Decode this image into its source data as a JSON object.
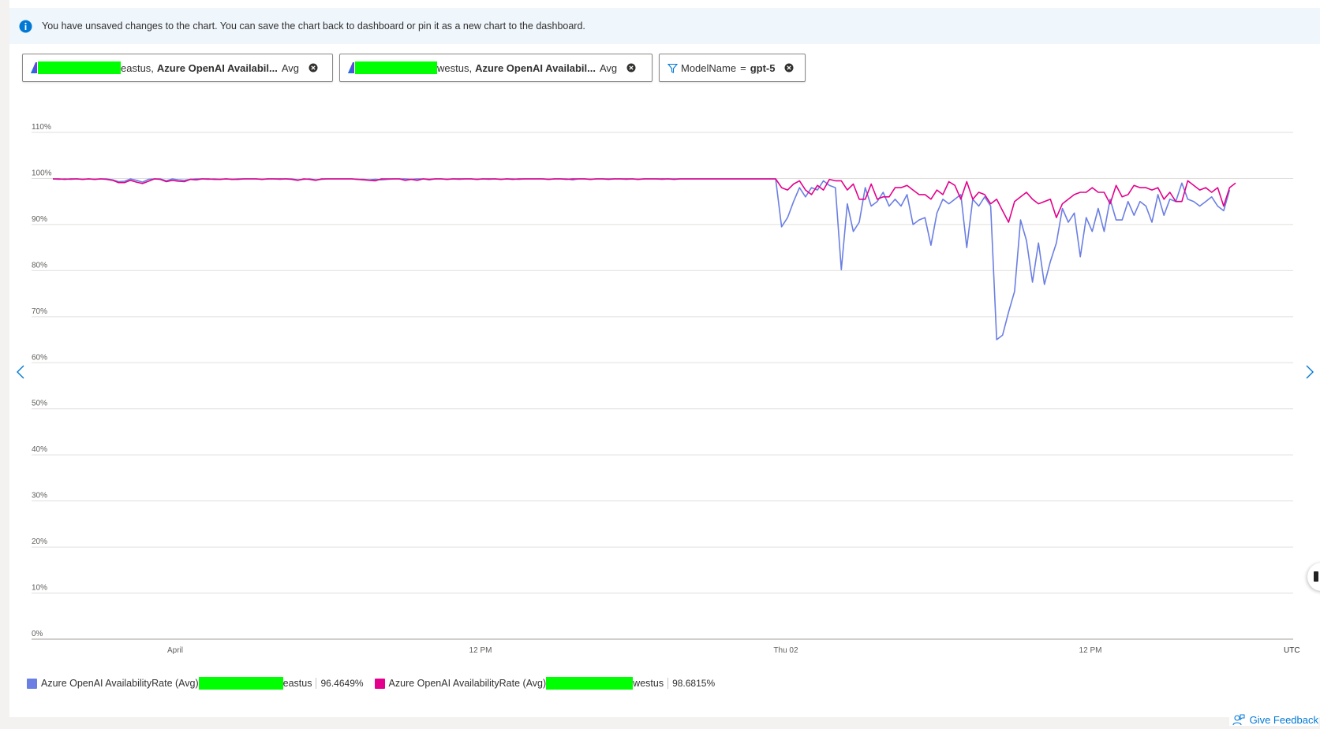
{
  "info_bar": {
    "icon": "info-icon",
    "message": "You have unsaved changes to the chart. You can save the chart back to dashboard or pin it as a new chart to the dashboard."
  },
  "pills": [
    {
      "resource_suffix": "eastus,",
      "metric": "Azure OpenAI Availabil...",
      "aggregation": "Avg"
    },
    {
      "resource_suffix": "westus,",
      "metric": "Azure OpenAI Availabil...",
      "aggregation": "Avg"
    }
  ],
  "filter": {
    "key": "ModelName",
    "operator": "=",
    "value": "gpt-5"
  },
  "chart_data": {
    "type": "line",
    "y_unit": "%",
    "ylim": [
      0,
      110
    ],
    "y_ticks": [
      "0%",
      "10%",
      "20%",
      "30%",
      "40%",
      "50%",
      "60%",
      "70%",
      "80%",
      "90%",
      "100%",
      "110%"
    ],
    "x_ticks": [
      "April",
      "12 PM",
      "Thu 02",
      "12 PM"
    ],
    "x_ticks_note_label": "UTC",
    "grid": true,
    "legend_position": "bottom-left",
    "series": [
      {
        "name": "Azure OpenAI AvailabilityRate (Avg)",
        "suffix": "eastus",
        "summary": "96.4649%",
        "color": "#6b7fe3",
        "values": [
          99.9,
          99.8,
          99.9,
          99.8,
          99.9,
          99.8,
          99.9,
          99.8,
          99.9,
          99.9,
          99.7,
          99.3,
          99.4,
          99.9,
          99.6,
          99.2,
          99.8,
          99.9,
          99.9,
          99.5,
          99.9,
          99.7,
          99.6,
          99.8,
          99.9,
          99.9,
          99.8,
          99.9,
          99.8,
          99.9,
          99.8,
          99.9,
          99.9,
          99.9,
          99.9,
          99.8,
          99.9,
          99.9,
          99.8,
          99.9,
          99.9,
          99.7,
          99.8,
          99.9,
          99.7,
          99.8,
          99.9,
          99.9,
          99.9,
          99.9,
          99.9,
          99.8,
          99.8,
          99.7,
          99.8,
          99.7,
          99.8,
          99.9,
          99.9,
          99.9,
          99.8,
          99.9,
          99.9,
          99.7,
          99.9,
          99.9,
          99.8,
          99.9,
          99.8,
          99.9,
          99.9,
          99.8,
          99.9,
          99.8,
          99.9,
          99.8,
          99.9,
          99.9,
          99.8,
          99.9,
          99.9,
          99.9,
          99.9,
          99.8,
          99.9,
          99.9,
          99.9,
          99.7,
          99.9,
          99.9,
          99.8,
          99.9,
          99.9,
          99.9,
          99.9,
          99.9,
          99.8,
          99.9,
          99.8,
          99.9,
          99.9,
          99.9,
          99.8,
          99.9,
          99.9,
          99.9,
          99.9,
          99.9,
          99.9,
          99.9,
          99.9,
          99.9,
          99.9,
          99.9,
          99.9,
          99.9,
          99.9,
          99.9,
          99.9,
          99.9,
          99.9,
          99.9,
          89.5,
          91.5,
          95,
          98,
          96,
          98,
          97.5,
          99.5,
          98.5,
          98,
          80.2,
          94.5,
          88.5,
          90.5,
          98,
          94,
          95,
          97,
          94,
          95.5,
          94,
          96.5,
          90,
          91,
          91.5,
          85.5,
          92.5,
          95.5,
          94.5,
          95.5,
          96.5,
          85,
          95.5,
          94,
          96,
          94,
          65,
          66,
          71,
          75.5,
          91,
          86.5,
          77.5,
          86,
          77,
          82,
          86,
          93.5,
          90.5,
          92.5,
          83,
          91.5,
          88.5,
          93.5,
          88.5,
          95.5,
          91,
          91,
          95,
          92,
          95,
          94,
          90.5,
          96.5,
          92,
          95.5,
          95,
          99,
          95.5,
          95,
          94,
          95,
          96,
          94,
          93,
          97.5
        ],
        "x_start_index": 0
      },
      {
        "name": "Azure OpenAI AvailabilityRate (Avg)",
        "suffix": "westus",
        "summary": "98.6815%",
        "color": "#e3008c",
        "values": [
          99.9,
          99.9,
          99.8,
          99.9,
          99.9,
          99.8,
          99.9,
          99.8,
          99.9,
          99.8,
          99.6,
          99.1,
          99.1,
          99.6,
          99.2,
          98.9,
          99.4,
          99.9,
          99.8,
          99.3,
          99.6,
          99.4,
          99.3,
          99.8,
          99.7,
          99.9,
          99.9,
          99.8,
          99.8,
          99.9,
          99.8,
          99.8,
          99.9,
          99.9,
          99.9,
          99.8,
          99.9,
          99.9,
          99.9,
          99.9,
          99.8,
          99.6,
          99.9,
          99.8,
          99.6,
          99.9,
          99.9,
          99.9,
          99.9,
          99.9,
          99.9,
          99.8,
          99.7,
          99.6,
          99.5,
          99.9,
          99.9,
          99.9,
          99.9,
          99.6,
          99.8,
          99.6,
          99.9,
          99.8,
          99.9,
          99.9,
          99.8,
          99.9,
          99.9,
          99.9,
          99.9,
          99.8,
          99.9,
          99.9,
          99.9,
          99.8,
          99.9,
          99.8,
          99.9,
          99.9,
          99.9,
          99.9,
          99.9,
          99.8,
          99.9,
          99.9,
          99.8,
          99.9,
          99.9,
          99.9,
          99.8,
          99.9,
          99.9,
          99.8,
          99.9,
          99.9,
          99.9,
          99.9,
          99.8,
          99.9,
          99.9,
          99.9,
          99.9,
          99.9,
          99.8,
          99.9,
          99.9,
          99.9,
          99.9,
          99.9,
          99.9,
          99.9,
          99.9,
          99.9,
          99.9,
          99.9,
          99.9,
          99.9,
          99.9,
          99.9,
          99.9,
          99.9,
          98,
          97.5,
          98.8,
          99.5,
          97.5,
          96.5,
          98.5,
          97.5,
          99.8,
          99.5,
          99.5,
          97.5,
          98.8,
          95.5,
          95.5,
          98.8,
          95.5,
          96,
          96,
          98,
          98,
          98.5,
          97.5,
          96.5,
          96.5,
          95.5,
          97.5,
          96.5,
          99.3,
          98.5,
          95.5,
          99.3,
          95.5,
          97,
          96.5,
          94.5,
          95.5,
          93,
          90.5,
          95,
          96,
          97,
          95.5,
          94.5,
          95,
          95.5,
          91.5,
          94.5,
          95.5,
          96.5,
          97,
          97,
          98,
          97,
          97,
          94.5,
          98.5,
          96,
          96.5,
          98.5,
          98,
          98,
          97.5,
          98,
          95.5,
          97,
          95,
          95,
          99.5,
          98.5,
          97.5,
          98,
          97,
          98,
          94,
          98,
          99
        ]
      }
    ],
    "x_count": 206
  },
  "feedback": {
    "label": "Give Feedback",
    "icon": "feedback-icon"
  },
  "nav": {
    "prev_icon": "chevron-left-icon",
    "next_icon": "chevron-right-icon"
  },
  "colors": {
    "accent": "#0078d4",
    "series_eastus": "#6b7fe3",
    "series_westus": "#e3008c",
    "redaction": "#00ff00"
  }
}
